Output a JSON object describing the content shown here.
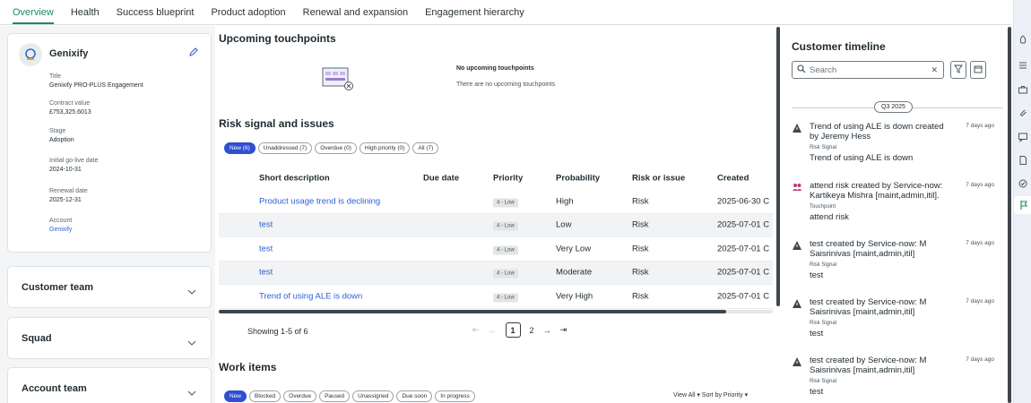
{
  "tabs": [
    "Overview",
    "Health",
    "Success blueprint",
    "Product adoption",
    "Renewal and expansion",
    "Engagement hierarchy"
  ],
  "account": {
    "name": "Genixify",
    "fields": [
      {
        "label": "Title",
        "value": "Genixify PRO-PLUS Engagement"
      },
      {
        "label": "Contract value",
        "value": "£753,325.6013"
      },
      {
        "label": "Stage",
        "value": "Adoption"
      },
      {
        "label": "Initial go-live date",
        "value": "2024-10-31"
      },
      {
        "label": "Renewal date",
        "value": "2025-12-31"
      },
      {
        "label": "Account",
        "value": "Genixify"
      }
    ]
  },
  "panels": [
    "Customer team",
    "Squad",
    "Account team"
  ],
  "touchpoints": {
    "title": "Upcoming touchpoints",
    "empty_title": "No upcoming touchpoints",
    "empty_text": "There are no upcoming touchpoints"
  },
  "risk": {
    "title": "Risk signal and issues",
    "filters": [
      "New (6)",
      "Unaddressed (7)",
      "Overdue (0)",
      "High priority (0)",
      "All (7)"
    ],
    "columns": [
      "Short description",
      "Due date",
      "Priority",
      "Probability",
      "Risk or issue",
      "Created"
    ],
    "rows": [
      {
        "desc": "Product usage trend is declining",
        "due": "",
        "priority": "4 - Low",
        "probability": "High",
        "type": "Risk",
        "created": "2025-06-30 C"
      },
      {
        "desc": "test",
        "due": "",
        "priority": "4 - Low",
        "probability": "Low",
        "type": "Risk",
        "created": "2025-07-01 C"
      },
      {
        "desc": "test",
        "due": "",
        "priority": "4 - Low",
        "probability": "Very Low",
        "type": "Risk",
        "created": "2025-07-01 C"
      },
      {
        "desc": "test",
        "due": "",
        "priority": "4 - Low",
        "probability": "Moderate",
        "type": "Risk",
        "created": "2025-07-01 C"
      },
      {
        "desc": "Trend of using ALE is down",
        "due": "",
        "priority": "4 - Low",
        "probability": "Very High",
        "type": "Risk",
        "created": "2025-07-01 C"
      }
    ],
    "showing": "Showing 1-5 of 6",
    "pages": [
      "1",
      "2"
    ],
    "current_page": "1"
  },
  "work": {
    "title": "Work items",
    "filters": [
      "New",
      "Blocked",
      "Overdue",
      "Paused",
      "Unassigned",
      "Due soon",
      "In progress"
    ],
    "view_all": "View All ▾ Sort by Priority ▾"
  },
  "timeline": {
    "title": "Customer timeline",
    "search_placeholder": "Search",
    "quarter": "Q3 2025",
    "events": [
      {
        "icon": "warning-icon",
        "text": "Trend of using ALE is down created by Jeremy Hess",
        "ago": "7 days ago",
        "kind": "Risk Signal",
        "sub": "Trend of using ALE is down"
      },
      {
        "icon": "people-icon",
        "text": "attend risk created by Service-now: Kartikeya Mishra [maint,admin,itil].",
        "ago": "7 days ago",
        "kind": "Touchpoint",
        "sub": "attend risk"
      },
      {
        "icon": "warning-icon",
        "text": "test created by Service-now: M Saisrinivas [maint,admin,itil]",
        "ago": "7 days ago",
        "kind": "Risk Signal",
        "sub": "test"
      },
      {
        "icon": "warning-icon",
        "text": "test created by Service-now: M Saisrinivas [maint,admin,itil]",
        "ago": "7 days ago",
        "kind": "Risk Signal",
        "sub": "test"
      },
      {
        "icon": "warning-icon",
        "text": "test created by Service-now: M Saisrinivas [maint,admin,itil]",
        "ago": "7 days ago",
        "kind": "Risk Signal",
        "sub": "test"
      }
    ]
  },
  "colors": {
    "accent_green": "#1d8a5f",
    "link_blue": "#2d61d3",
    "chip_active": "#2f4ed1",
    "touchpoint_pink": "#c13b7a"
  }
}
